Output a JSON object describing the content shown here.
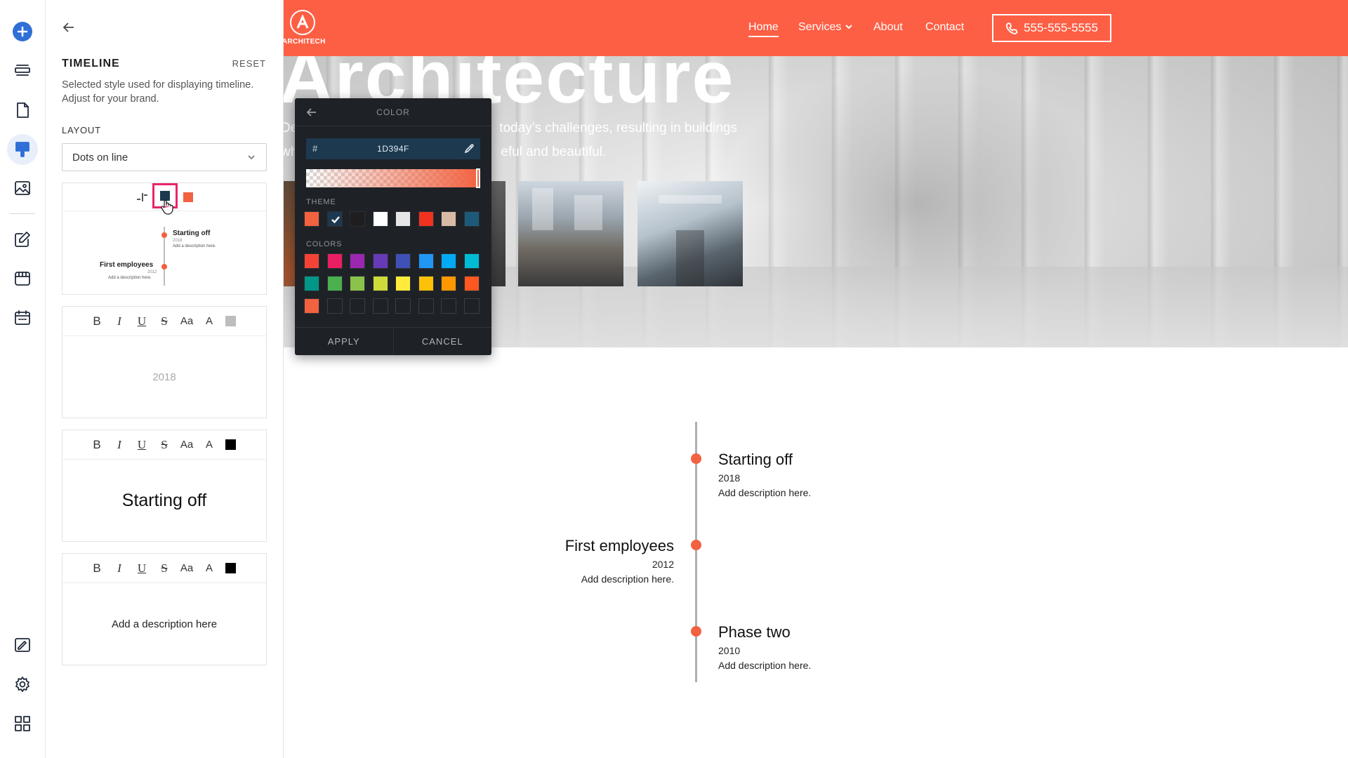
{
  "rail": {
    "items": [
      "add",
      "pages-stack",
      "document",
      "brush",
      "image",
      "edit",
      "store",
      "calendar",
      "design-edit",
      "settings",
      "widgets"
    ]
  },
  "panel": {
    "title": "TIMELINE",
    "reset": "RESET",
    "description": "Selected style used for displaying timeline. Adjust for your brand.",
    "layout_label": "LAYOUT",
    "layout_value": "Dots on line",
    "preview": {
      "items": [
        {
          "title": "Starting off",
          "year": "2018",
          "desc": "Add a description here."
        },
        {
          "title": "First employees",
          "year": "2012",
          "desc": "Add a description here."
        }
      ],
      "dark_color": "#1D394F",
      "accent_color": "#F26140"
    },
    "format_cards": [
      {
        "text": "2018",
        "swatch": "#BDBDBD"
      },
      {
        "text": "Starting off",
        "swatch": "#000000"
      },
      {
        "text": "Add a description here",
        "swatch": "#000000"
      }
    ],
    "format_buttons": [
      "B",
      "I",
      "U",
      "S",
      "Aa",
      "A"
    ]
  },
  "site": {
    "logo_text": "ARCHITECH",
    "nav": [
      {
        "label": "Home",
        "active": true
      },
      {
        "label": "Services",
        "dropdown": true
      },
      {
        "label": "About"
      },
      {
        "label": "Contact"
      }
    ],
    "phone": "555-555-5555",
    "hero_title": "Architecture",
    "hero_line1_a": "De",
    "hero_line1_b": "today’s challenges, resulting in buildings",
    "hero_line2_a": "wh",
    "hero_line2_b": "eful and beautiful.",
    "brand_color": "#FD5F45"
  },
  "picker": {
    "title": "COLOR",
    "hash": "#",
    "hex_value": "1D394F",
    "theme_label": "THEME",
    "colors_label": "COLORS",
    "apply": "APPLY",
    "cancel": "CANCEL",
    "theme_swatches": [
      "#F26140",
      "#1D394F",
      "#1E1E1E",
      "#FFFFFF",
      "#E6E6E6",
      "#F0321E",
      "#D9BBA5",
      "#1D5A7A"
    ],
    "selected_theme_index": 1,
    "color_rows": [
      [
        "#F44336",
        "#E91E63",
        "#9C27B0",
        "#673AB7",
        "#3F51B5",
        "#2196F3",
        "#03A9F4",
        "#00BCD4"
      ],
      [
        "#009688",
        "#4CAF50",
        "#8BC34A",
        "#CDDC39",
        "#FFEB3B",
        "#FFC107",
        "#FF9800",
        "#FF5722"
      ],
      [
        "#F26140",
        "",
        "",
        "",
        "",
        "",
        "",
        ""
      ]
    ]
  },
  "timeline": {
    "entries": [
      {
        "title": "Starting off",
        "year": "2018",
        "desc": "Add description here.",
        "side": "right"
      },
      {
        "title": "First employees",
        "year": "2012",
        "desc": "Add description here.",
        "side": "left"
      },
      {
        "title": "Phase two",
        "year": "2010",
        "desc": "Add description here.",
        "side": "right"
      }
    ],
    "dot_color": "#F26140"
  }
}
